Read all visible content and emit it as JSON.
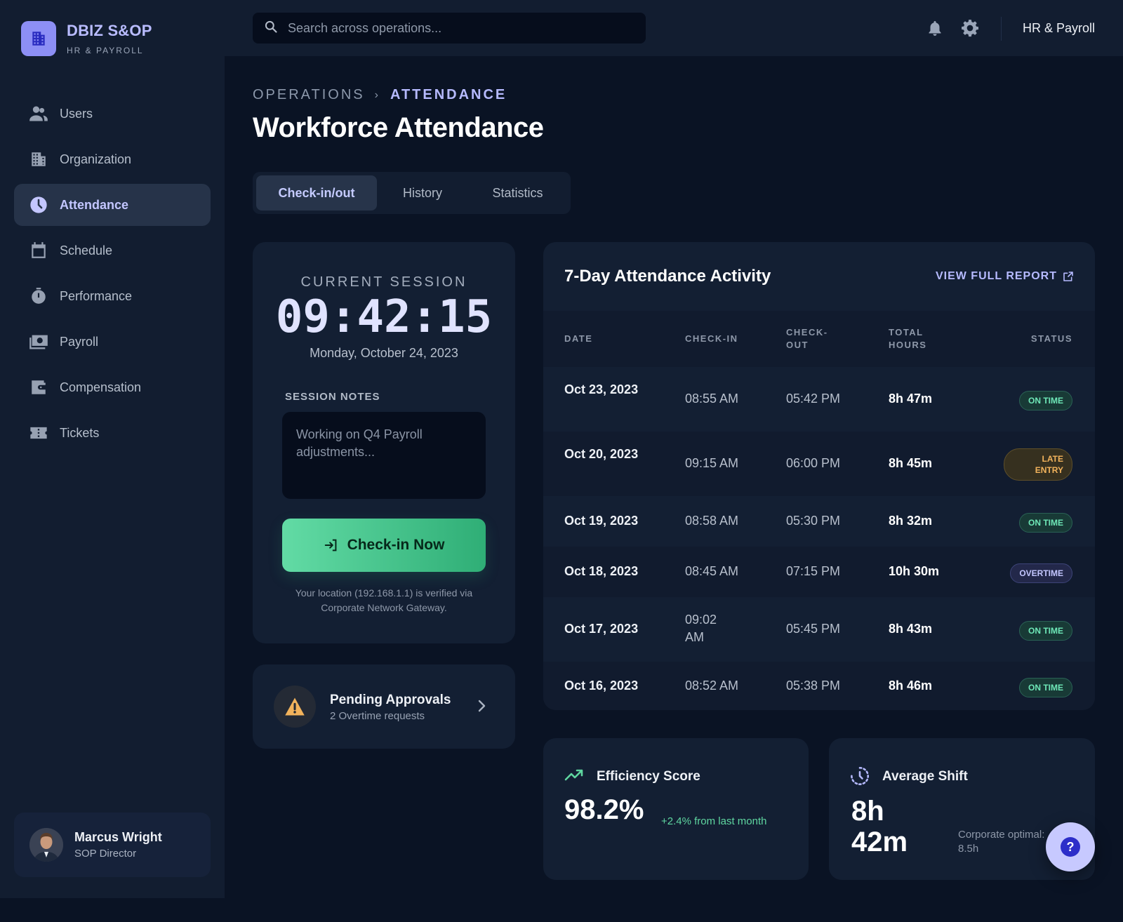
{
  "brand": {
    "title": "DBIZ S&OP",
    "subtitle": "HR & PAYROLL",
    "icon": "building-icon"
  },
  "sidebar": {
    "items": [
      {
        "label": "Users",
        "icon": "users-icon",
        "active": false
      },
      {
        "label": "Organization",
        "icon": "building-icon",
        "active": false
      },
      {
        "label": "Attendance",
        "icon": "clock-icon",
        "active": true
      },
      {
        "label": "Schedule",
        "icon": "calendar-icon",
        "active": false
      },
      {
        "label": "Performance",
        "icon": "stopwatch-icon",
        "active": false
      },
      {
        "label": "Payroll",
        "icon": "cash-icon",
        "active": false
      },
      {
        "label": "Compensation",
        "icon": "wallet-icon",
        "active": false
      },
      {
        "label": "Tickets",
        "icon": "ticket-icon",
        "active": false
      }
    ]
  },
  "user": {
    "name": "Marcus Wright",
    "role": "SOP Director"
  },
  "topbar": {
    "search_placeholder": "Search across operations...",
    "workspace_label": "HR & Payroll"
  },
  "breadcrumb": {
    "parent": "OPERATIONS",
    "current": "ATTENDANCE"
  },
  "page": {
    "title": "Workforce Attendance"
  },
  "tabs": [
    {
      "label": "Check-in/out",
      "active": true
    },
    {
      "label": "History",
      "active": false
    },
    {
      "label": "Statistics",
      "active": false
    }
  ],
  "session": {
    "label": "CURRENT SESSION",
    "time": "09:42:15",
    "date": "Monday, October 24, 2023",
    "notes_label": "SESSION NOTES",
    "notes_placeholder": "Working on Q4 Payroll adjustments...",
    "button_label": "Check-in Now",
    "location_note": "Your location (192.168.1.1) is verified via Corporate Network Gateway."
  },
  "pending": {
    "title": "Pending Approvals",
    "subtitle": "2 Overtime requests"
  },
  "activity": {
    "title": "7-Day Attendance Activity",
    "report_link": "VIEW FULL REPORT",
    "columns": {
      "date": "DATE",
      "check_in": "CHECK-IN",
      "check_out": "CHECK-OUT",
      "total_hours": "TOTAL HOURS",
      "status": "STATUS"
    },
    "rows": [
      {
        "date": "Oct 23, 2023",
        "check_in": "08:55 AM",
        "check_out": "05:42 PM",
        "total_hours": "8h 47m",
        "status": "ON TIME"
      },
      {
        "date": "Oct 20, 2023",
        "check_in": "09:15 AM",
        "check_out": "06:00 PM",
        "total_hours": "8h 45m",
        "status": "LATE ENTRY"
      },
      {
        "date": "Oct 19, 2023",
        "check_in": "08:58 AM",
        "check_out": "05:30 PM",
        "total_hours": "8h 32m",
        "status": "ON TIME"
      },
      {
        "date": "Oct 18, 2023",
        "check_in": "08:45 AM",
        "check_out": "07:15 PM",
        "total_hours": "10h 30m",
        "status": "OVERTIME"
      },
      {
        "date": "Oct 17, 2023",
        "check_in": "09:02 AM",
        "check_out": "05:45 PM",
        "total_hours": "8h 43m",
        "status": "ON TIME"
      },
      {
        "date": "Oct 16, 2023",
        "check_in": "08:52 AM",
        "check_out": "05:38 PM",
        "total_hours": "8h 46m",
        "status": "ON TIME"
      }
    ]
  },
  "efficiency": {
    "title": "Efficiency Score",
    "value": "98.2%",
    "delta": "+2.4% from last month"
  },
  "average_shift": {
    "title": "Average Shift",
    "value": "8h 42m",
    "note_line1": "Corporate optimal:",
    "note_line2": "8.5h"
  },
  "colors": {
    "accent": "#b6baff",
    "success": "#5fd6a0",
    "warning": "#f2b35c",
    "background": "#0a1324",
    "panel": "#131f33"
  }
}
